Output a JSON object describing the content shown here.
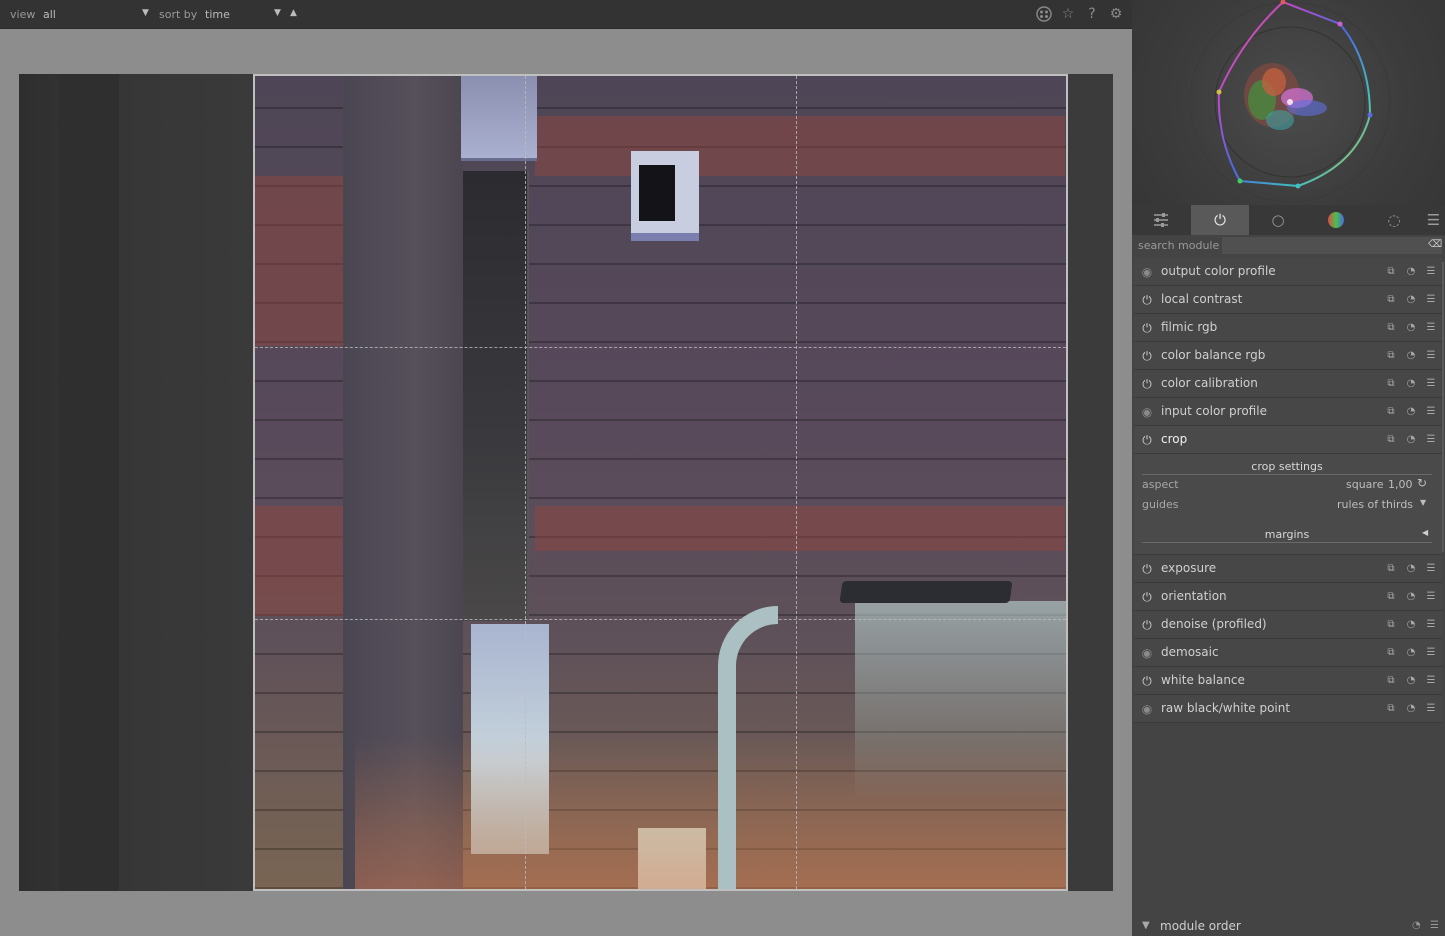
{
  "topbar": {
    "view_label": "view",
    "view_value": "all",
    "sort_label": "sort by",
    "sort_value": "time",
    "icons": [
      "grouping-icon",
      "star-icon",
      "help-icon",
      "gear-icon"
    ]
  },
  "right_panel": {
    "tabs": [
      {
        "name": "quick-access-tab",
        "glyph": "☰"
      },
      {
        "name": "active-modules-tab",
        "glyph": "⏻"
      },
      {
        "name": "base-modules-tab",
        "glyph": "○"
      },
      {
        "name": "color-modules-tab",
        "glyph": "●"
      },
      {
        "name": "correct-modules-tab",
        "glyph": "◌"
      }
    ],
    "search_label": "search module",
    "search_value": "",
    "modules_top": [
      {
        "name": "output color profile",
        "enabled": false
      },
      {
        "name": "local contrast",
        "enabled": true
      },
      {
        "name": "filmic rgb",
        "enabled": true
      },
      {
        "name": "color balance rgb",
        "enabled": true
      },
      {
        "name": "color calibration",
        "enabled": true
      },
      {
        "name": "input color profile",
        "enabled": false
      },
      {
        "name": "crop",
        "enabled": true
      }
    ],
    "crop_settings": {
      "header": "crop settings",
      "aspect_label": "aspect",
      "aspect_value": "square",
      "aspect_ratio": "1,00",
      "guides_label": "guides",
      "guides_value": "rules of thirds",
      "margins_label": "margins"
    },
    "modules_bottom": [
      {
        "name": "exposure",
        "enabled": true
      },
      {
        "name": "orientation",
        "enabled": true
      },
      {
        "name": "denoise (profiled)",
        "enabled": true
      },
      {
        "name": "demosaic",
        "enabled": false
      },
      {
        "name": "white balance",
        "enabled": true
      },
      {
        "name": "raw black/white point",
        "enabled": false
      }
    ],
    "footer_label": "module order"
  }
}
